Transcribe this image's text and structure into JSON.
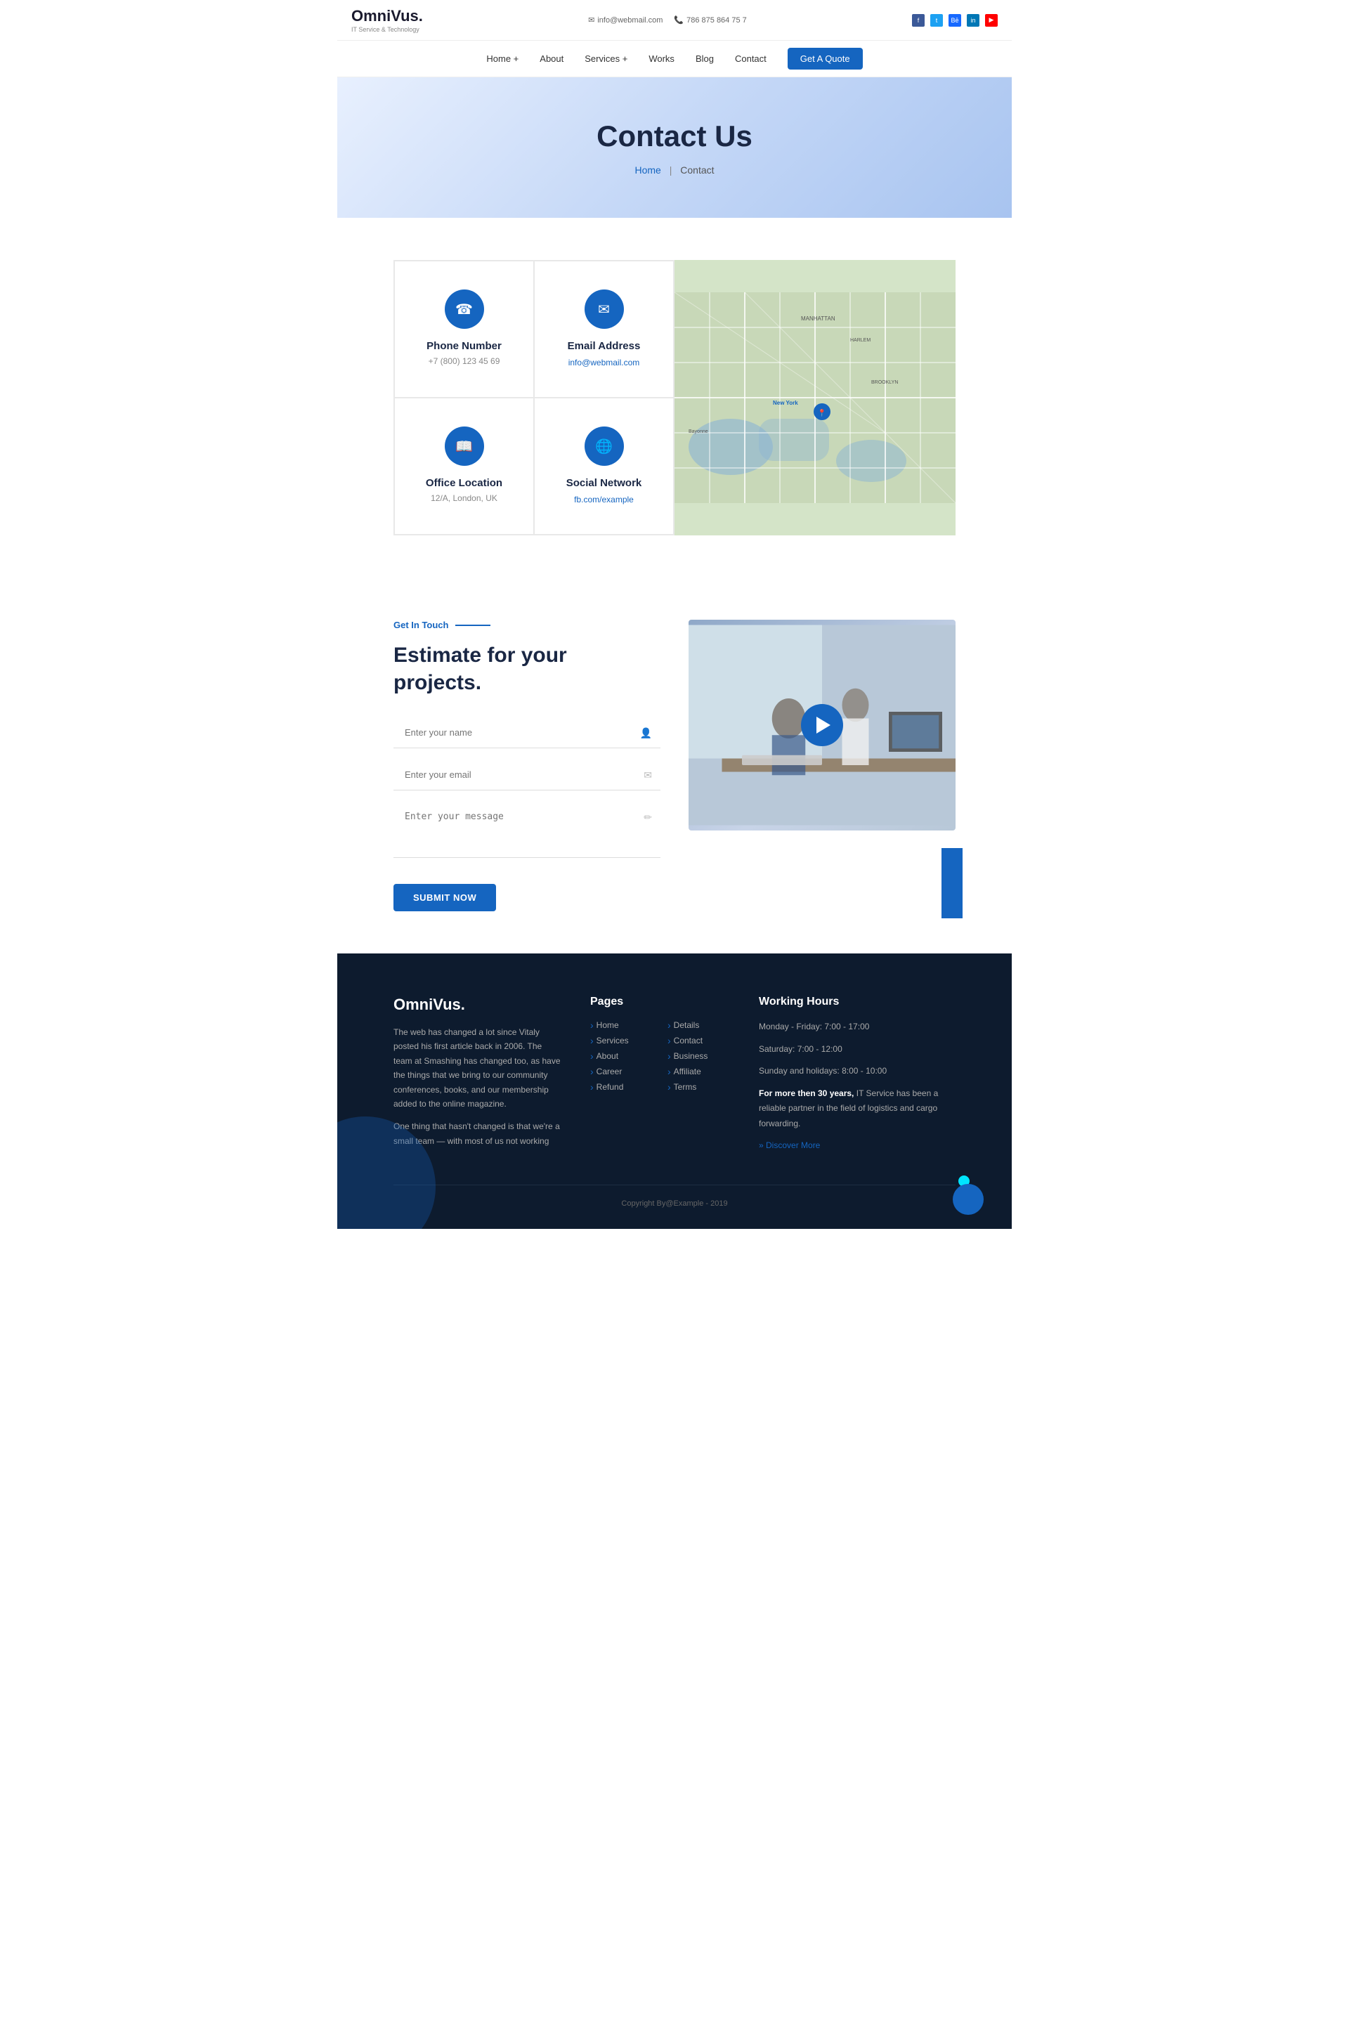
{
  "header": {
    "logo_text": "OmniVus.",
    "logo_sub": "IT Service & Technology",
    "email_icon": "✉",
    "email": "info@webmail.com",
    "phone_icon": "📞",
    "phone": "786 875 864 75 7",
    "social": [
      {
        "name": "facebook",
        "label": "f"
      },
      {
        "name": "twitter",
        "label": "t"
      },
      {
        "name": "behance",
        "label": "Bē"
      },
      {
        "name": "linkedin",
        "label": "in"
      },
      {
        "name": "youtube",
        "label": "▶"
      }
    ]
  },
  "nav": {
    "items": [
      {
        "label": "Home +",
        "href": "#"
      },
      {
        "label": "About",
        "href": "#"
      },
      {
        "label": "Services +",
        "href": "#"
      },
      {
        "label": "Works",
        "href": "#"
      },
      {
        "label": "Blog",
        "href": "#"
      },
      {
        "label": "Contact",
        "href": "#"
      }
    ],
    "cta_label": "Get A Quote"
  },
  "hero": {
    "title": "Contact Us",
    "breadcrumb_home": "Home",
    "breadcrumb_current": "Contact"
  },
  "contact_info": {
    "cards": [
      {
        "icon": "☎",
        "title": "Phone Number",
        "value": "+7 (800) 123 45 69"
      },
      {
        "icon": "✉",
        "title": "Email Address",
        "value": "info@webmail.com",
        "is_link": true
      },
      {
        "icon": "📖",
        "title": "Office Location",
        "value": "12/A, London, UK"
      },
      {
        "icon": "🌐",
        "title": "Social Network",
        "value": "fb.com/example",
        "is_link": true
      }
    ]
  },
  "estimate": {
    "tag": "Get In Touch",
    "title": "Estimate for your projects.",
    "form": {
      "name_placeholder": "Enter your name",
      "email_placeholder": "Enter your email",
      "message_placeholder": "Enter your message",
      "submit_label": "Submit Now"
    }
  },
  "footer": {
    "brand_name": "OmniVus.",
    "brand_desc1": "The web has changed a lot since Vitaly posted his first article back in 2006. The team at Smashing has changed too, as have the things that we bring to our community conferences, books, and our membership added to the online magazine.",
    "brand_desc2": "One thing that hasn't changed is that we're a small team — with most of us not working",
    "pages_title": "Pages",
    "pages": [
      {
        "label": "Home",
        "href": "#"
      },
      {
        "label": "Details",
        "href": "#"
      },
      {
        "label": "Services",
        "href": "#"
      },
      {
        "label": "Contact",
        "href": "#"
      },
      {
        "label": "About",
        "href": "#"
      },
      {
        "label": "Business",
        "href": "#"
      },
      {
        "label": "Career",
        "href": "#"
      },
      {
        "label": "Affiliate",
        "href": "#"
      },
      {
        "label": "Refund",
        "href": "#"
      },
      {
        "label": "Terms",
        "href": "#"
      }
    ],
    "hours_title": "Working Hours",
    "hours": [
      "Monday - Friday: 7:00 - 17:00",
      "Saturday: 7:00 - 12:00",
      "Sunday and holidays: 8:00 - 10:00"
    ],
    "hours_desc": "For more then 30 years, IT Service has been a reliable partner in the field of logistics and cargo forwarding.",
    "discover_label": "» Discover More",
    "copyright": "Copyright By@Example - 2019"
  }
}
